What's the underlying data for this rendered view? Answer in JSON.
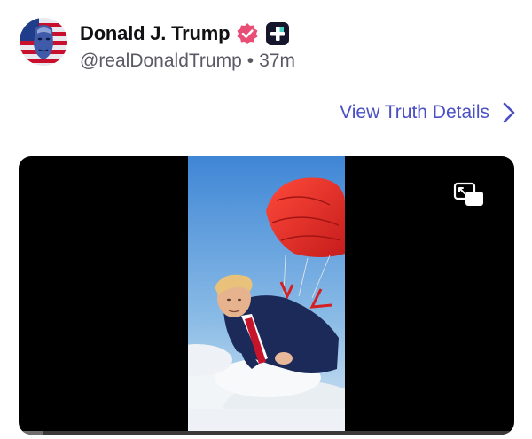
{
  "post": {
    "author": {
      "display_name": "Donald J. Trump",
      "handle": "@realDonaldTrump",
      "verified": true
    },
    "separator": "•",
    "timestamp": "37m",
    "view_details_label": "View Truth Details"
  },
  "video": {
    "progress_fraction": 0.05
  },
  "icons": {
    "verified": "verified-badge-icon",
    "plus_badge": "truth-plus-icon",
    "chevron": "chevron-right-icon",
    "pip": "picture-in-picture-icon"
  },
  "colors": {
    "accent": "#4b4fc4",
    "verified": "#e94d75",
    "text_primary": "#111114",
    "text_secondary": "#5a5a66",
    "video_bg": "#000000"
  }
}
